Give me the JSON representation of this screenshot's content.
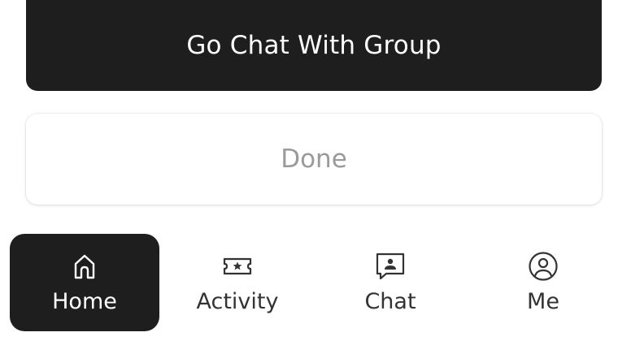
{
  "buttons": {
    "go_chat_label": "Go Chat With Group",
    "done_label": "Done"
  },
  "nav": {
    "items": [
      {
        "label": "Home",
        "icon": "home-icon",
        "active": true
      },
      {
        "label": "Activity",
        "icon": "ticket-star-icon",
        "active": false
      },
      {
        "label": "Chat",
        "icon": "chat-contact-icon",
        "active": false
      },
      {
        "label": "Me",
        "icon": "user-circle-icon",
        "active": false
      }
    ]
  },
  "colors": {
    "primary": "#1e1e1e",
    "on_primary": "#ffffff",
    "muted_text": "#9a9a9a",
    "nav_text": "#333333"
  }
}
